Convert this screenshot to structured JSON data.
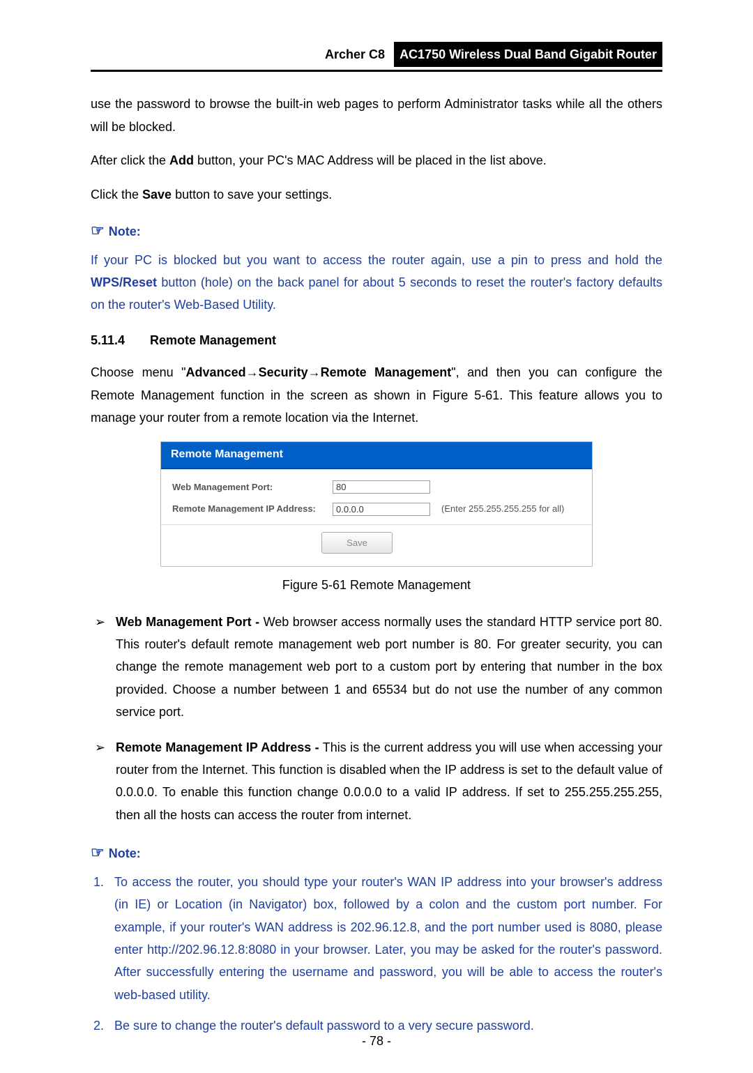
{
  "header": {
    "model": "Archer C8",
    "product": "AC1750 Wireless Dual Band Gigabit Router"
  },
  "intro": {
    "p1": "use the password to browse the built-in web pages to perform Administrator tasks while all the others will be blocked.",
    "p2_before": "After click the ",
    "p2_bold": "Add",
    "p2_after": " button, your PC's MAC Address will be placed in the list above.",
    "p3_before": "Click the ",
    "p3_bold": "Save",
    "p3_after": " button to save your settings."
  },
  "note1": {
    "label": "Note:",
    "body_before": "If your PC is blocked but you want to access the router again, use a pin to press and hold the ",
    "body_bold": "WPS/Reset",
    "body_after": " button (hole) on the back panel for about 5 seconds to reset the router's factory defaults on the router's Web-Based Utility."
  },
  "section": {
    "num": "5.11.4",
    "title": "Remote Management",
    "p_before": "Choose menu \"",
    "path_a": "Advanced",
    "path_b": "Security",
    "path_c": "Remote Management",
    "p_mid": "\", and then you can configure the Remote Management function in the screen as shown in ",
    "fig_ref": "Figure 5-61",
    "p_after": ". This feature allows you to manage your router from a remote location via the Internet."
  },
  "panel": {
    "title": "Remote Management",
    "port_label": "Web Management Port:",
    "port_value": "80",
    "ip_label": "Remote Management IP Address:",
    "ip_value": "0.0.0.0",
    "ip_hint": "(Enter 255.255.255.255 for all)",
    "save": "Save"
  },
  "figure_caption": "Figure 5-61 Remote Management",
  "bullets": {
    "b1_bold": "Web Management Port -",
    "b1_text": " Web browser access normally uses the standard HTTP service port 80. This router's default remote management web port number is 80. For greater security, you can change the remote management web port to a custom port by entering that number in the box provided. Choose a number between 1 and 65534 but do not use the number of any common service port.",
    "b2_bold": "Remote Management IP Address -",
    "b2_text": " This is the current address you will use when accessing your router from the Internet. This function is disabled when the IP address is set to the default value of 0.0.0.0. To enable this function change 0.0.0.0 to a valid IP address. If set to 255.255.255.255, then all the hosts can access the router from internet."
  },
  "note2": {
    "label": "Note:",
    "li1": "To access the router, you should type your router's WAN IP address into your browser's address (in IE) or Location (in Navigator) box, followed by a colon and the custom port number. For example, if your router's WAN address is 202.96.12.8, and the port number used is 8080, please enter http://202.96.12.8:8080 in your browser. Later, you may be asked for the router's password. After successfully entering the username and password, you will be able to access the router's web-based utility.",
    "li2": "Be sure to change the router's default password to a very secure password."
  },
  "page_number": "- 78 -"
}
